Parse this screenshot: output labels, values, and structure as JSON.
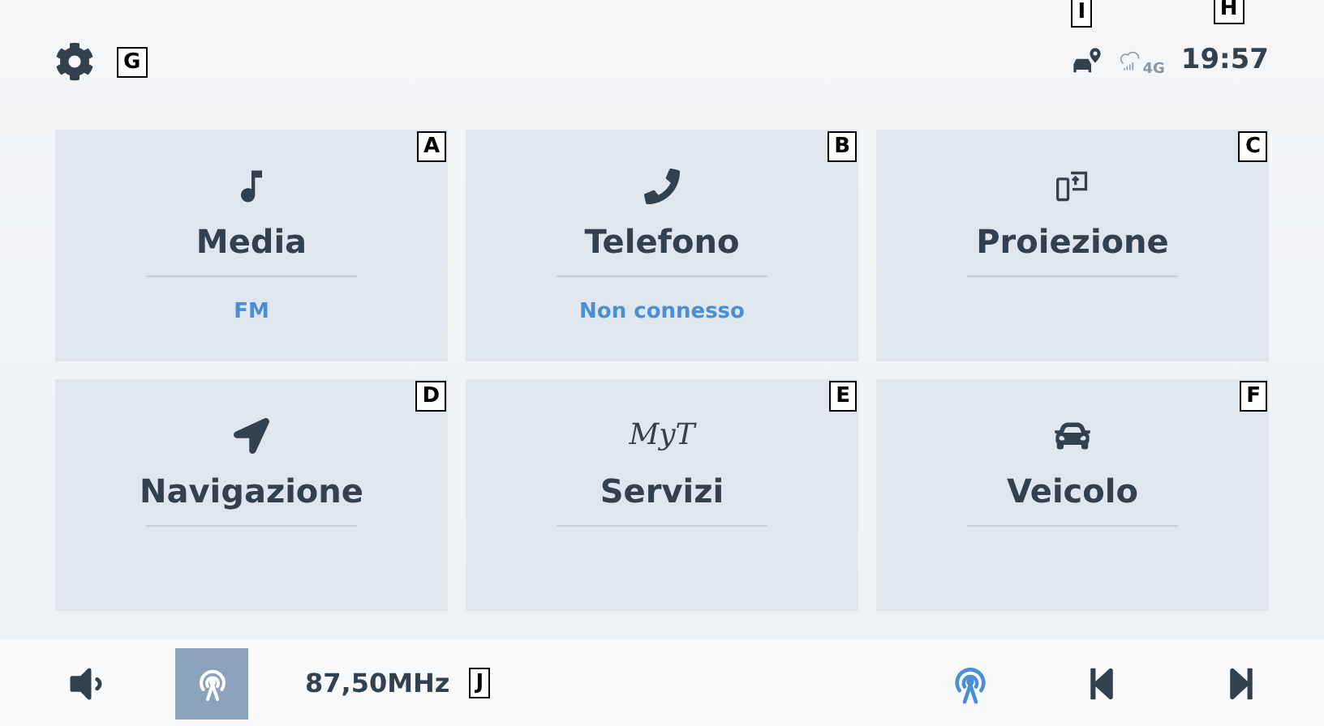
{
  "top_bar": {
    "settings_callout": "G",
    "location_callout": "I",
    "network_label": "4G",
    "clock": "19:57",
    "clock_callout": "H"
  },
  "tiles": [
    {
      "kind": "music",
      "label": "Media",
      "subtitle": "FM",
      "callout": "A"
    },
    {
      "kind": "phone",
      "label": "Telefono",
      "subtitle": "Non connesso",
      "callout": "B"
    },
    {
      "kind": "projection",
      "label": "Proiezione",
      "callout": "C"
    },
    {
      "kind": "navigation",
      "label": "Navigazione",
      "callout": "D"
    },
    {
      "kind": "logo",
      "logo_text": "MyT",
      "label": "Servizi",
      "callout": "E"
    },
    {
      "kind": "car",
      "label": "Veicolo",
      "callout": "F"
    }
  ],
  "bottom_bar": {
    "source_selected": true,
    "radio_on": true,
    "frequency": "87,50MHz",
    "frequency_callout": "J"
  }
}
